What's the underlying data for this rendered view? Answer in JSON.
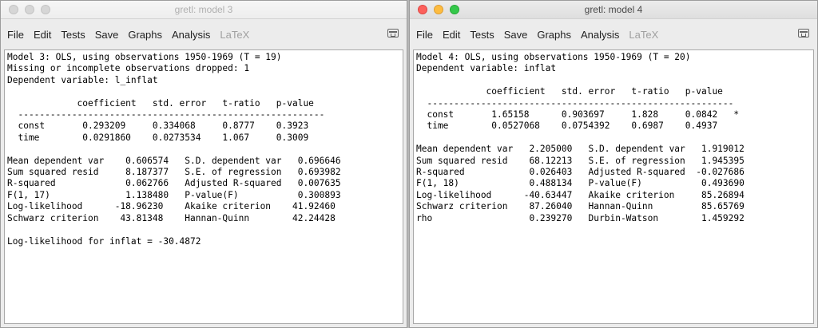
{
  "windows": [
    {
      "title": "gretl: model 3",
      "menu": [
        "File",
        "Edit",
        "Tests",
        "Save",
        "Graphs",
        "Analysis",
        "LaTeX"
      ],
      "output_lines": [
        "Model 3: OLS, using observations 1950-1969 (T = 19)",
        "Missing or incomplete observations dropped: 1",
        "Dependent variable: l_inflat",
        "",
        "             coefficient   std. error   t-ratio   p-value",
        "  ---------------------------------------------------------",
        "  const       0.293209     0.334068     0.8777    0.3923",
        "  time        0.0291860    0.0273534    1.067     0.3009",
        "",
        "Mean dependent var    0.606574   S.D. dependent var   0.696646",
        "Sum squared resid     8.187377   S.E. of regression   0.693982",
        "R-squared             0.062766   Adjusted R-squared   0.007635",
        "F(1, 17)              1.138480   P-value(F)           0.300893",
        "Log-likelihood      -18.96230    Akaike criterion    41.92460",
        "Schwarz criterion    43.81348    Hannan-Quinn        42.24428",
        "",
        "Log-likelihood for inflat = -30.4872"
      ]
    },
    {
      "title": "gretl: model 4",
      "menu": [
        "File",
        "Edit",
        "Tests",
        "Save",
        "Graphs",
        "Analysis",
        "LaTeX"
      ],
      "output_lines": [
        "Model 4: OLS, using observations 1950-1969 (T = 20)",
        "Dependent variable: inflat",
        "",
        "             coefficient   std. error   t-ratio   p-value",
        "  ---------------------------------------------------------",
        "  const       1.65158      0.903697     1.828     0.0842   *",
        "  time        0.0527068    0.0754392    0.6987    0.4937",
        "",
        "Mean dependent var   2.205000   S.D. dependent var   1.919012",
        "Sum squared resid    68.12213   S.E. of regression   1.945395",
        "R-squared            0.026403   Adjusted R-squared  -0.027686",
        "F(1, 18)             0.488134   P-value(F)           0.493690",
        "Log-likelihood      -40.63447   Akaike criterion     85.26894",
        "Schwarz criterion    87.26040   Hannan-Quinn         85.65769",
        "rho                  0.239270   Durbin-Watson        1.459292"
      ]
    }
  ]
}
